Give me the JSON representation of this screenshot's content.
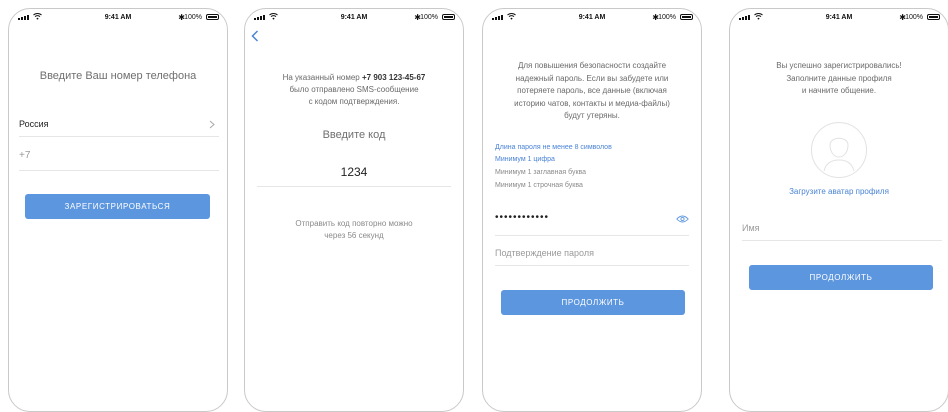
{
  "status_bar": {
    "time": "9:41 AM",
    "battery": "100%"
  },
  "screen1": {
    "title": "Введите Ваш номер телефона",
    "country_label": "Россия",
    "phone_prefix": "+7",
    "register_button": "ЗАРЕГИСТРИРОВАТЬСЯ"
  },
  "screen2": {
    "message_prefix": "На указанный номер ",
    "phone_number": "+7 903 123-45-67",
    "message_line2": "было отправлено SMS-сообщение",
    "message_line3": "с кодом подтверждения.",
    "enter_code_label": "Введите код",
    "code_value": "1234",
    "resend_line1": "Отправить код повторно можно",
    "resend_line2": "через 56 секунд"
  },
  "screen3": {
    "info_lines": [
      "Для повышения безопасности создайте",
      "надежный пароль. Если вы забудете или",
      "потеряете пароль, все данные (включая",
      "историю чатов, контакты и медиа-файлы)",
      "будут утеряны."
    ],
    "requirements": [
      {
        "text": "Длина пароля не менее 8 символов",
        "met": true
      },
      {
        "text": "Минимум 1 цифра",
        "met": true
      },
      {
        "text": "Минимум 1 заглавная буква",
        "met": false
      },
      {
        "text": "Минимум 1 строчная буква",
        "met": false
      }
    ],
    "password_masked": "••••••••••••",
    "confirm_placeholder": "Подтверждение пароля",
    "continue_button": "ПРОДОЛЖИТЬ"
  },
  "screen4": {
    "info_lines": [
      "Вы успешно зарегистрировались!",
      "Заполните данные профиля",
      "и начните общение."
    ],
    "upload_avatar_link": "Загрузите аватар профиля",
    "name_placeholder": "Имя",
    "continue_button": "ПРОДОЛЖИТЬ"
  },
  "colors": {
    "accent": "#5c96df",
    "link": "#4a84d6"
  },
  "icons": {
    "back": "chevron-left-icon",
    "chevron": "chevron-right-icon",
    "eye": "eye-icon",
    "avatar": "avatar-placeholder-icon"
  }
}
